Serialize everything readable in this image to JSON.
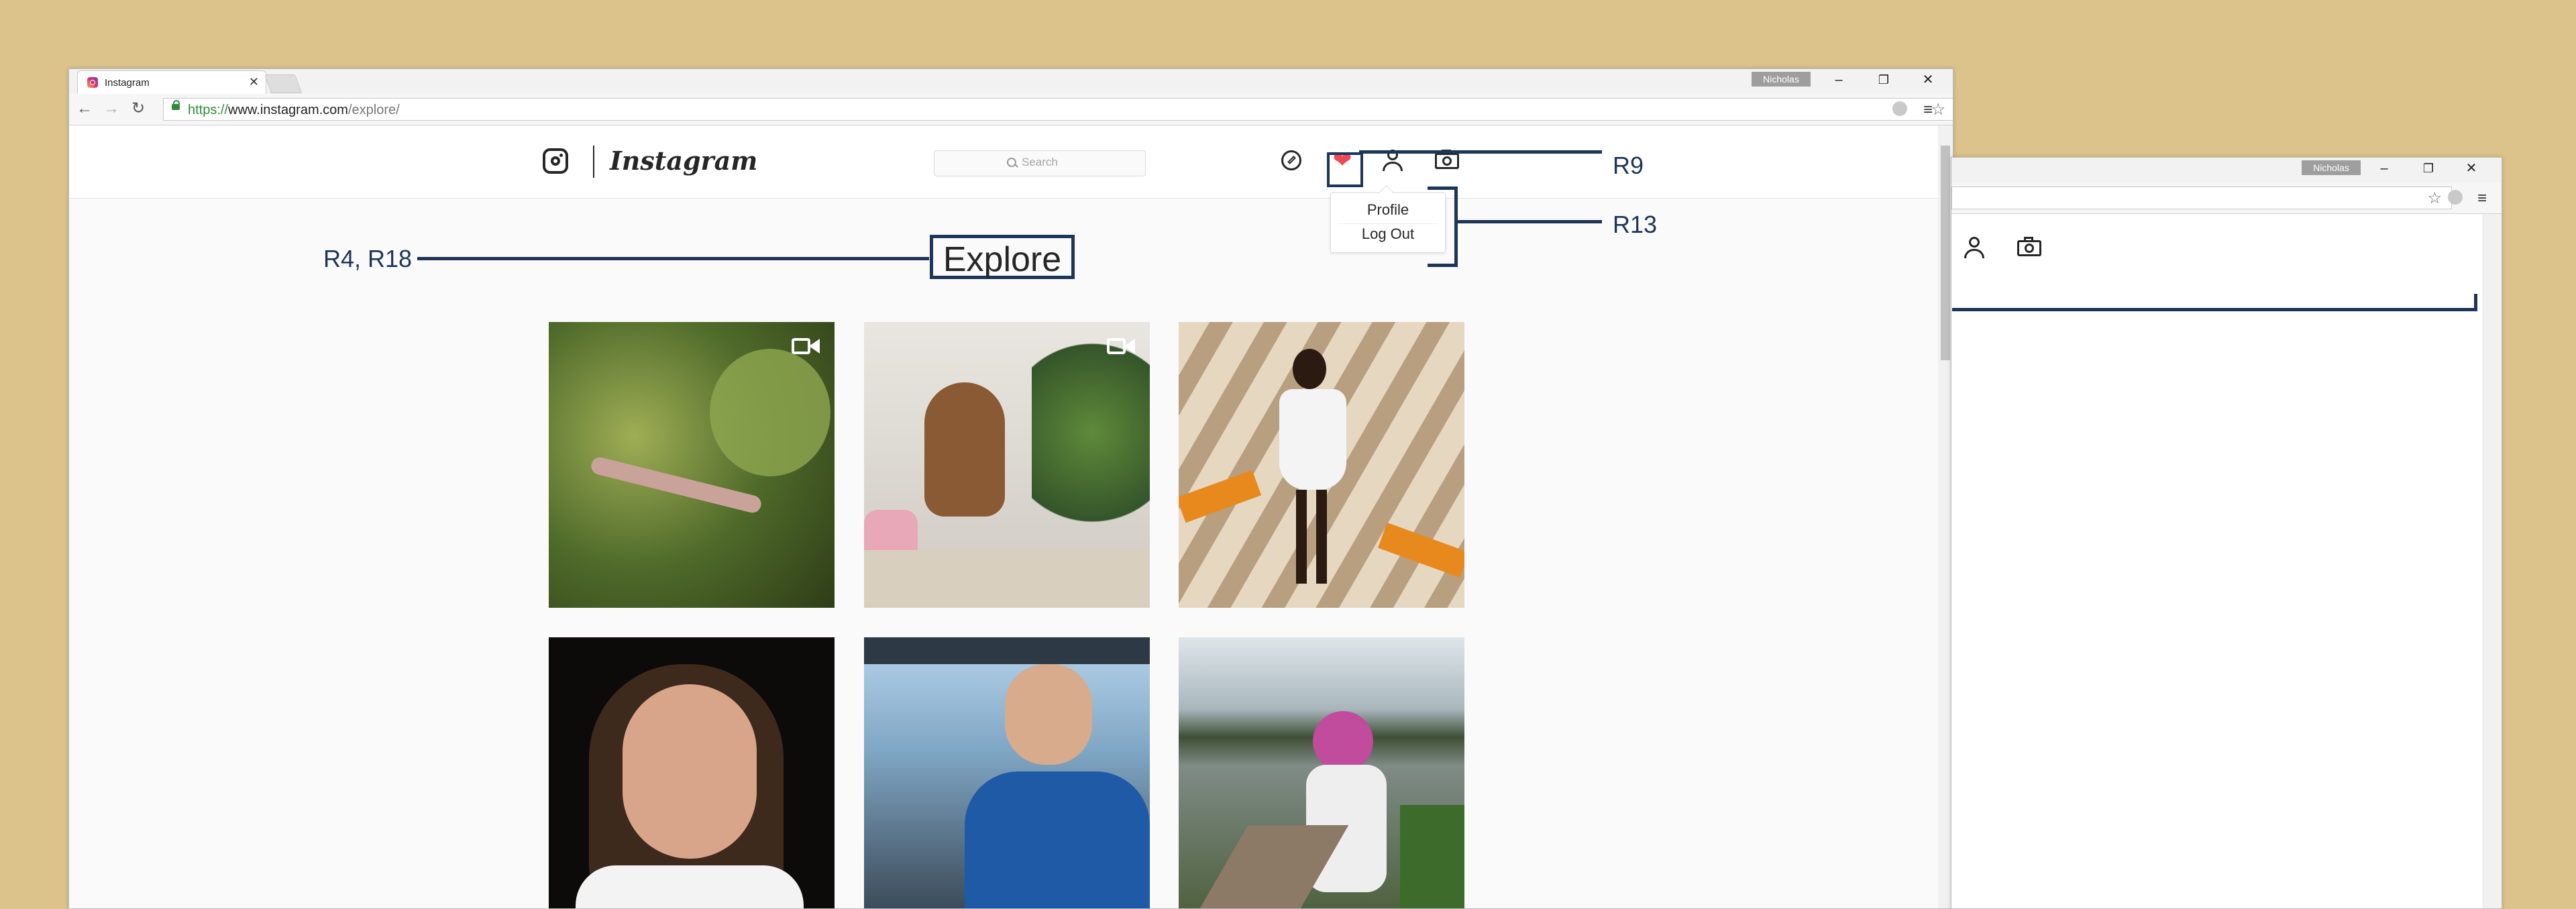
{
  "browser": {
    "tab_title": "Instagram",
    "tab_close": "✕",
    "profile_name": "Nicholas",
    "window_controls": {
      "minimize": "–",
      "restore": "❐",
      "close": "✕"
    },
    "nav": {
      "back": "←",
      "forward": "→",
      "reload": "↻"
    },
    "url_scheme": "https://",
    "url_host": "www.instagram.com",
    "url_path": "/explore/",
    "bookmark_star": "☆",
    "menu_icon": "≡"
  },
  "instagram": {
    "wordmark": "Instagram",
    "search_placeholder": "Search",
    "nav_icons": [
      "compass-icon",
      "heart-icon",
      "user-icon",
      "camera-icon"
    ],
    "heart_color": "#ed4956",
    "heart_glyph": "❤",
    "dropdown": {
      "profile": "Profile",
      "logout": "Log Out"
    },
    "page_title": "Explore",
    "photos": [
      {
        "subject": "caterpillar on leaves",
        "video": true
      },
      {
        "subject": "cat beside plant",
        "video": true
      },
      {
        "subject": "woman in white dress",
        "video": false
      },
      {
        "subject": "woman portrait",
        "video": false
      },
      {
        "subject": "pilot in cockpit",
        "video": false
      },
      {
        "subject": "person by lake",
        "video": false
      }
    ]
  },
  "annotations": {
    "left_label": "R4, R18",
    "heart_label": "R9",
    "menu_label": "R13",
    "color": "#1d3557"
  },
  "background_color": "#dcc38c",
  "second_window": {
    "profile_name": "Nicholas",
    "window_controls": {
      "minimize": "–",
      "restore": "❐",
      "close": "✕"
    },
    "bookmark_star": "☆",
    "menu_icon": "≡"
  }
}
